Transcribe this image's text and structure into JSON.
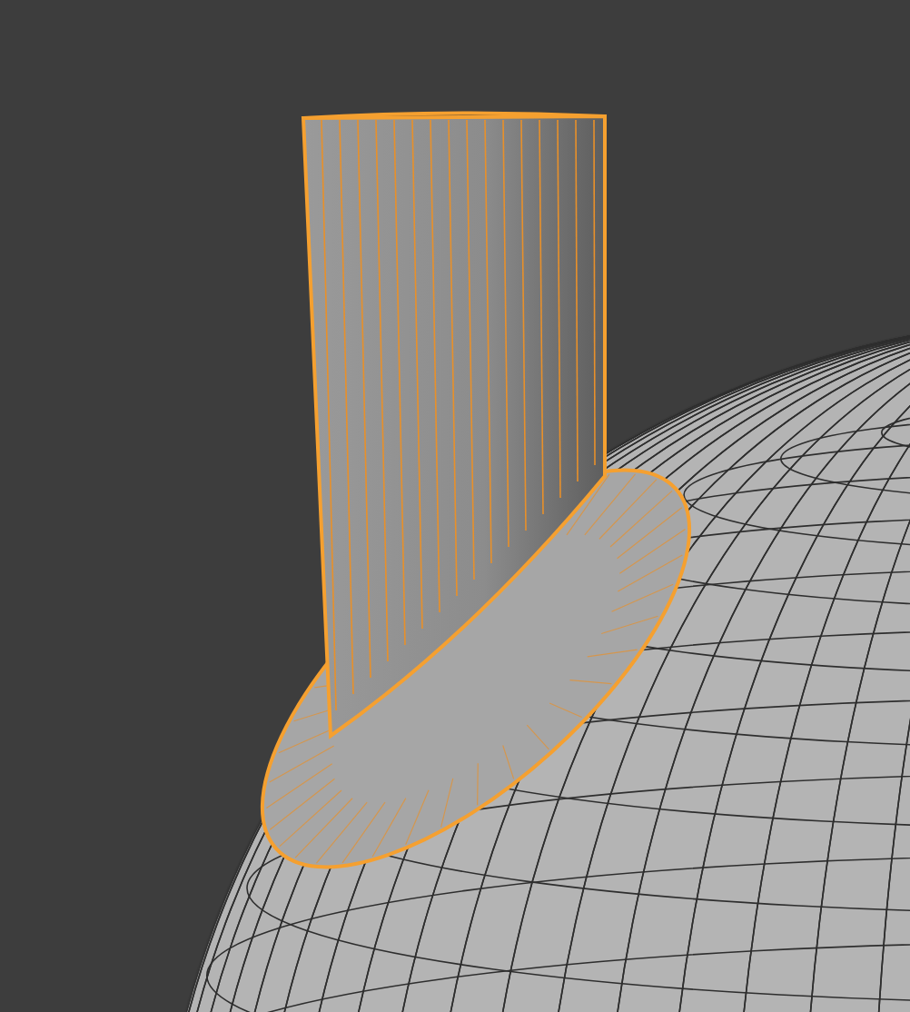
{
  "viewport": {
    "objects": [
      {
        "kind": "sphere",
        "selected": false
      },
      {
        "kind": "disc",
        "selected": true
      },
      {
        "kind": "cylinder",
        "selected": true
      }
    ]
  }
}
